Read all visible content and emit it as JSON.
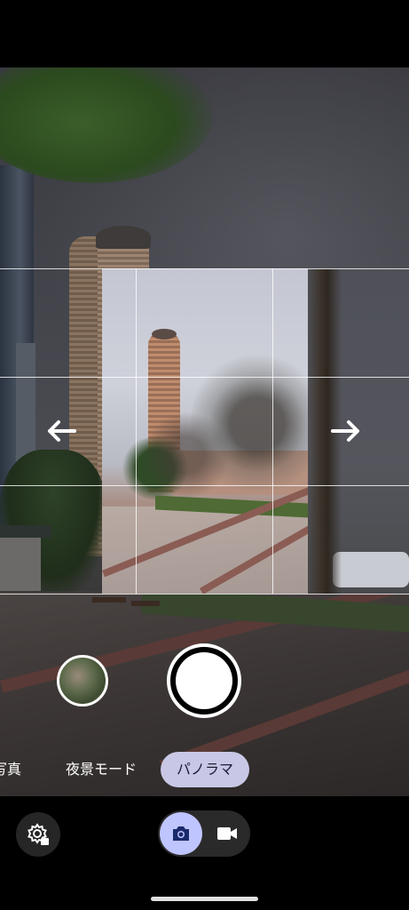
{
  "modes": {
    "photo": "写真",
    "night": "夜景モード",
    "panorama": "パノラマ"
  },
  "active_mode": "panorama",
  "icons": {
    "pan_left": "arrow-left-icon",
    "pan_right": "arrow-right-icon",
    "settings": "settings-gear-icon",
    "camera": "camera-icon",
    "video": "video-camera-icon"
  },
  "colors": {
    "active_mode_bg": "#c8c8e6",
    "photo_toggle_bg": "#bfc5ff"
  }
}
